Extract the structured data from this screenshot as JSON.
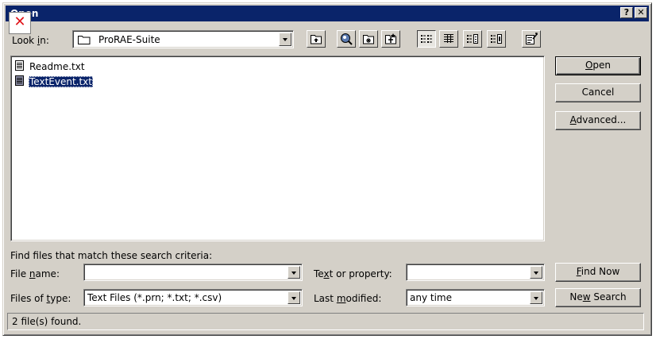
{
  "window": {
    "title": "Open",
    "help_btn": "?",
    "close_btn": "✕"
  },
  "lookin": {
    "label_pre": "Look ",
    "label_key": "i",
    "label_post": "n:",
    "value": "ProRAE-Suite"
  },
  "toolbar": {
    "icons": [
      "up-one-level-icon",
      "search-web-icon",
      "create-folder-icon",
      "add-to-favorites-icon",
      "list-view-icon",
      "details-view-icon",
      "properties-view-icon",
      "preview-view-icon",
      "commands-settings-icon"
    ]
  },
  "files": [
    {
      "name": "Readme.txt",
      "icon": "text-file-icon",
      "selected": false
    },
    {
      "name": "TextEvent.txt",
      "icon": "text-file-icon",
      "selected": true
    }
  ],
  "buttons": {
    "open_key": "O",
    "open_rest": "pen",
    "cancel": "Cancel",
    "advanced_key": "A",
    "advanced_rest": "dvanced...",
    "find_pre": "",
    "find_key": "F",
    "find_post": "ind Now",
    "new_pre": "Ne",
    "new_key": "w",
    "new_post": " Search"
  },
  "criteria": {
    "heading": "Find files that match these search criteria:",
    "filename_pre": "File ",
    "filename_key": "n",
    "filename_post": "ame:",
    "filename_value": "",
    "filetype_pre": "Files of ",
    "filetype_key": "t",
    "filetype_post": "ype:",
    "filetype_value": "Text Files (*.prn; *.txt; *.csv)",
    "text_pre": "Te",
    "text_key": "x",
    "text_post": "t or property:",
    "text_value": "",
    "modified_pre": "Last ",
    "modified_key": "m",
    "modified_post": "odified:",
    "modified_value": "any time"
  },
  "status": {
    "text": "2 file(s) found."
  },
  "colors": {
    "titlebar": "#0a246a",
    "face": "#d4d0c8",
    "selection": "#0a246a"
  }
}
